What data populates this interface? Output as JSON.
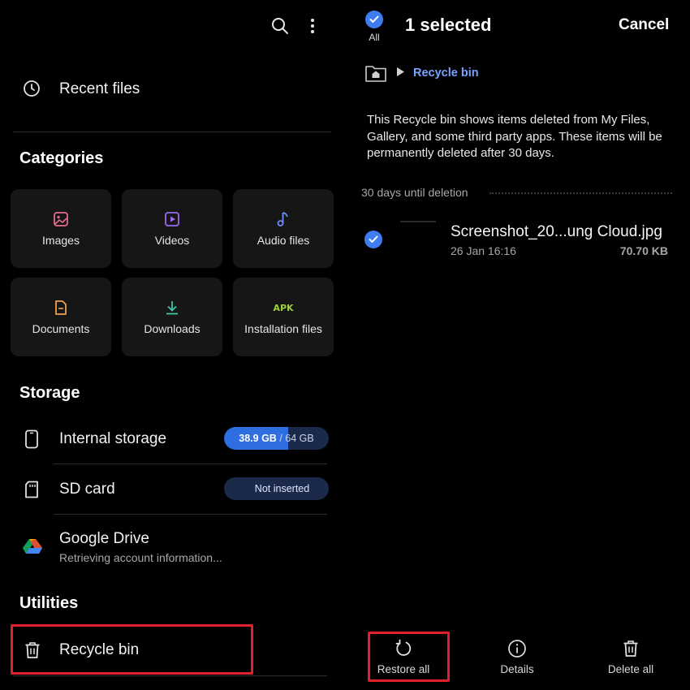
{
  "left": {
    "recent_files_label": "Recent files",
    "categories_title": "Categories",
    "categories": [
      {
        "label": "Images",
        "icon": "image-icon",
        "color": "#e86a8c"
      },
      {
        "label": "Videos",
        "icon": "video-icon",
        "color": "#9b6cf0"
      },
      {
        "label": "Audio files",
        "icon": "music-note-icon",
        "color": "#6a8cf5"
      },
      {
        "label": "Documents",
        "icon": "document-icon",
        "color": "#f0a050"
      },
      {
        "label": "Downloads",
        "icon": "download-icon",
        "color": "#3fc7a5"
      },
      {
        "label": "Installation files",
        "icon": "apk-icon",
        "color": "#9ed13c",
        "badge": "APK"
      }
    ],
    "storage_title": "Storage",
    "internal_storage": {
      "label": "Internal storage",
      "used": "38.9 GB",
      "total": "/ 64 GB",
      "used_fraction": 0.61
    },
    "sd_card": {
      "label": "SD card",
      "status": "Not inserted"
    },
    "google_drive": {
      "label": "Google Drive",
      "subtitle": "Retrieving account information..."
    },
    "utilities_title": "Utilities",
    "recycle_bin_label": "Recycle bin"
  },
  "right": {
    "all_label": "All",
    "selected_count": "1 selected",
    "cancel_label": "Cancel",
    "breadcrumb_label": "Recycle bin",
    "info_text": "This Recycle bin shows items deleted from My Files, Gallery, and some third party apps. These items will be permanently deleted after 30 days.",
    "group_label": "30 days until deletion",
    "file": {
      "name": "Screenshot_20...ung Cloud.jpg",
      "date": "26 Jan 16:16",
      "size": "70.70 KB"
    },
    "actions": {
      "restore_all": "Restore all",
      "details": "Details",
      "delete_all": "Delete all"
    }
  },
  "colors": {
    "accent_blue": "#3e7cf0",
    "highlight_red": "#e0202a",
    "breadcrumb_blue": "#7aa2ff"
  }
}
